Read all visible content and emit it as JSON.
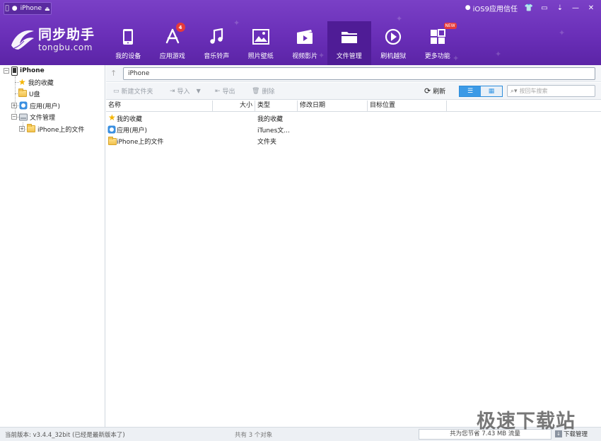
{
  "titlebar": {
    "device_tab": "iPhone",
    "trust_label": "iOS9应用信任"
  },
  "logo": {
    "name_cn": "同步助手",
    "name_en": "tongbu.com"
  },
  "nav": {
    "items": [
      {
        "label": "我的设备",
        "icon": "phone-icon"
      },
      {
        "label": "应用游戏",
        "icon": "app-store-icon",
        "badge": "4"
      },
      {
        "label": "音乐铃声",
        "icon": "music-note-icon"
      },
      {
        "label": "照片壁纸",
        "icon": "picture-icon"
      },
      {
        "label": "视频影片",
        "icon": "film-icon"
      },
      {
        "label": "文件管理",
        "icon": "folder-icon",
        "active": true
      },
      {
        "label": "刷机越狱",
        "icon": "flash-icon"
      },
      {
        "label": "更多功能",
        "icon": "grid-icon",
        "badge": "NEW"
      }
    ]
  },
  "sidebar": {
    "root": "iPhone",
    "items": [
      "我的收藏",
      "U盘",
      "应用(用户)",
      "文件管理",
      "iPhone上的文件"
    ]
  },
  "address": {
    "path": "iPhone"
  },
  "toolbar": {
    "new_folder": "新建文件夹",
    "import": "导入",
    "export": "导出",
    "delete": "删除",
    "refresh": "刷新",
    "search_placeholder": "按回车搜索"
  },
  "table": {
    "columns": [
      "名称",
      "大小",
      "类型",
      "修改日期",
      "目标位置"
    ],
    "rows": [
      {
        "name": "我的收藏",
        "size": "",
        "type": "我的收藏",
        "date": "",
        "target": "",
        "icon": "star-icon"
      },
      {
        "name": "应用(用户)",
        "size": "",
        "type": "iTunes文...",
        "date": "",
        "target": "",
        "icon": "app-icon"
      },
      {
        "name": "iPhone上的文件",
        "size": "",
        "type": "文件夹",
        "date": "",
        "target": "",
        "icon": "folder-icon"
      }
    ]
  },
  "status": {
    "version": "当前版本: v3.4.4_32bit  (已经是最新版本了)",
    "count": "共有 3 个对象",
    "traffic": "共为您节省  7.43 MB 流量",
    "download": "下载管理"
  },
  "watermark": "极速下载站",
  "colors": {
    "header": "#6a2fb8",
    "active_nav": "#4f1c96",
    "accent_blue": "#3c9ae6",
    "badge_red": "#e63a3a"
  }
}
